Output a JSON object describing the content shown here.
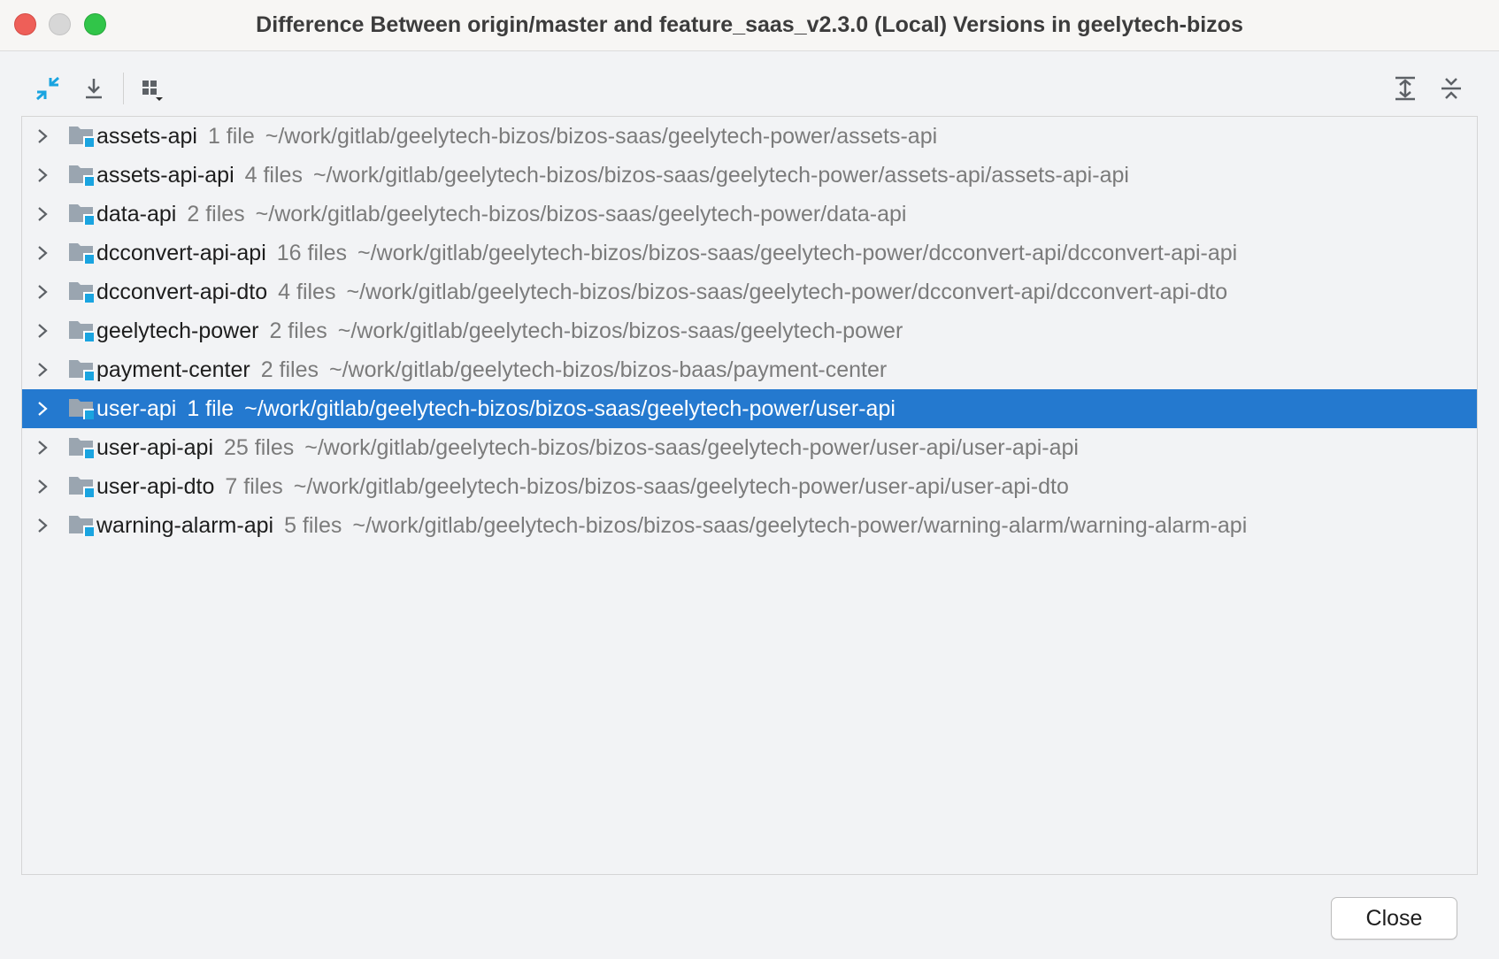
{
  "window": {
    "title": "Difference Between origin/master and feature_saas_v2.3.0 (Local) Versions in geelytech-bizos"
  },
  "toolbar": {
    "left_icons": [
      "compare-icon",
      "download-icon",
      "group-by-icon"
    ],
    "right_icons": [
      "expand-all-icon",
      "collapse-all-icon"
    ]
  },
  "colors": {
    "accent": "#2479cf",
    "icon_blue": "#1aa4e0",
    "folder_gray": "#9aa5b0"
  },
  "tree": {
    "items": [
      {
        "name": "assets-api",
        "count": "1 file",
        "path": "~/work/gitlab/geelytech-bizos/bizos-saas/geelytech-power/assets-api",
        "selected": false
      },
      {
        "name": "assets-api-api",
        "count": "4 files",
        "path": "~/work/gitlab/geelytech-bizos/bizos-saas/geelytech-power/assets-api/assets-api-api",
        "selected": false
      },
      {
        "name": "data-api",
        "count": "2 files",
        "path": "~/work/gitlab/geelytech-bizos/bizos-saas/geelytech-power/data-api",
        "selected": false
      },
      {
        "name": "dcconvert-api-api",
        "count": "16 files",
        "path": "~/work/gitlab/geelytech-bizos/bizos-saas/geelytech-power/dcconvert-api/dcconvert-api-api",
        "selected": false
      },
      {
        "name": "dcconvert-api-dto",
        "count": "4 files",
        "path": "~/work/gitlab/geelytech-bizos/bizos-saas/geelytech-power/dcconvert-api/dcconvert-api-dto",
        "selected": false
      },
      {
        "name": "geelytech-power",
        "count": "2 files",
        "path": "~/work/gitlab/geelytech-bizos/bizos-saas/geelytech-power",
        "selected": false
      },
      {
        "name": "payment-center",
        "count": "2 files",
        "path": "~/work/gitlab/geelytech-bizos/bizos-baas/payment-center",
        "selected": false
      },
      {
        "name": "user-api",
        "count": "1 file",
        "path": "~/work/gitlab/geelytech-bizos/bizos-saas/geelytech-power/user-api",
        "selected": true
      },
      {
        "name": "user-api-api",
        "count": "25 files",
        "path": "~/work/gitlab/geelytech-bizos/bizos-saas/geelytech-power/user-api/user-api-api",
        "selected": false
      },
      {
        "name": "user-api-dto",
        "count": "7 files",
        "path": "~/work/gitlab/geelytech-bizos/bizos-saas/geelytech-power/user-api/user-api-dto",
        "selected": false
      },
      {
        "name": "warning-alarm-api",
        "count": "5 files",
        "path": "~/work/gitlab/geelytech-bizos/bizos-saas/geelytech-power/warning-alarm/warning-alarm-api",
        "selected": false
      }
    ]
  },
  "footer": {
    "close_label": "Close"
  }
}
